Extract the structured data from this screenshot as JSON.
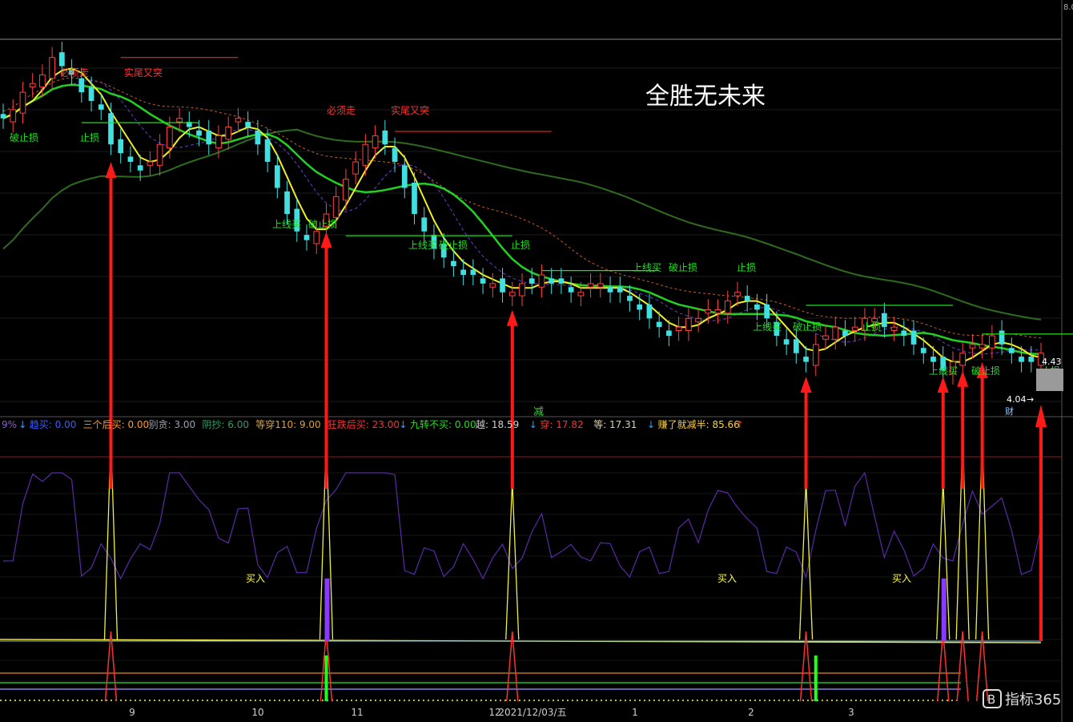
{
  "title": "全胜无未来",
  "top_axis_label": "8.0",
  "price_labels": {
    "last": "4.43",
    "low": "4.04"
  },
  "wealth_label": "财",
  "reduce_label": "减",
  "indicator_bar": [
    {
      "text": "9%",
      "color": "#8a5bd6"
    },
    {
      "text": "↓",
      "color": "#30a0ff"
    },
    {
      "text": "趋买: 0.00",
      "color": "#3a5cff"
    },
    {
      "text": "三个后买: 0.00",
      "color": "#ff9a2a"
    },
    {
      "text": "别贪: 3.00",
      "color": "#9aa0b0"
    },
    {
      "text": "阴抄: 6.00",
      "color": "#2f9e6a"
    },
    {
      "text": "等穿110: 9.00",
      "color": "#e0a030"
    },
    {
      "text": "狂跌后买: 23.00",
      "color": "#ff3030"
    },
    {
      "text": "↓",
      "color": "#30a0ff"
    },
    {
      "text": "九转不买: 0.00",
      "color": "#20e020"
    },
    {
      "text": "越: 18.59",
      "color": "#d0d0d0"
    },
    {
      "text": "↓",
      "color": "#30a0ff"
    },
    {
      "text": "穿: 17.82",
      "color": "#ff3030"
    },
    {
      "text": "等: 17.31",
      "color": "#e0d0a0"
    },
    {
      "text": "↓",
      "color": "#30a0ff"
    },
    {
      "text": "赚了就减半: 85.66",
      "color": "#ffd040"
    },
    {
      "text": "↑",
      "color": "#ff3030"
    }
  ],
  "annotations": [
    {
      "text": "必须走",
      "color": "#ff3030"
    },
    {
      "text": "实尾又突",
      "color": "#ff3030"
    },
    {
      "text": "必须走",
      "color": "#ff3030"
    },
    {
      "text": "实尾又突",
      "color": "#ff3030"
    },
    {
      "text": "破止损",
      "color": "#20e020"
    },
    {
      "text": "止损",
      "color": "#20e020"
    },
    {
      "text": "上线买",
      "color": "#20e020"
    },
    {
      "text": "破止损",
      "color": "#20e020"
    },
    {
      "text": "上线买",
      "color": "#20e020"
    },
    {
      "text": "破止损",
      "color": "#20e020"
    },
    {
      "text": "止损",
      "color": "#20e020"
    },
    {
      "text": "上线买",
      "color": "#20e020"
    },
    {
      "text": "破止损",
      "color": "#20e020"
    },
    {
      "text": "止损",
      "color": "#20e020"
    },
    {
      "text": "上线买",
      "color": "#20e020"
    },
    {
      "text": "破止损",
      "color": "#20e020"
    },
    {
      "text": "止损",
      "color": "#20e020"
    },
    {
      "text": "上线买",
      "color": "#20e020"
    },
    {
      "text": "破止损",
      "color": "#20e020"
    },
    {
      "text": "止损",
      "color": "#20e020"
    },
    {
      "text": "买入",
      "color": "#ffff40"
    },
    {
      "text": "买入",
      "color": "#ffff40"
    },
    {
      "text": "买入",
      "color": "#ffff40"
    }
  ],
  "watermark": "指标365",
  "chart_data": {
    "type": "line",
    "title": "全胜无未来",
    "x_ticks": [
      "9",
      "10",
      "11",
      "12",
      "2021/12/03/五",
      "1",
      "2",
      "3"
    ],
    "price_ylim": [
      3.9,
      8.0
    ],
    "closes": [
      7.1,
      7.2,
      7.4,
      7.5,
      7.6,
      7.8,
      7.7,
      7.6,
      7.4,
      7.3,
      7.2,
      6.8,
      6.7,
      6.6,
      6.5,
      6.6,
      6.8,
      7.0,
      7.1,
      7.0,
      6.9,
      6.8,
      6.9,
      7.0,
      7.1,
      7.0,
      6.8,
      6.6,
      6.3,
      6.0,
      5.8,
      5.7,
      5.8,
      6.0,
      6.2,
      6.4,
      6.6,
      6.8,
      6.9,
      6.8,
      6.6,
      6.3,
      6.0,
      5.8,
      5.6,
      5.5,
      5.4,
      5.3,
      5.3,
      5.2,
      5.2,
      5.1,
      5.1,
      5.2,
      5.2,
      5.3,
      5.2,
      5.2,
      5.1,
      5.1,
      5.2,
      5.2,
      5.1,
      5.1,
      5.0,
      4.9,
      4.8,
      4.7,
      4.6,
      4.7,
      4.8,
      4.8,
      4.9,
      4.9,
      5.0,
      5.1,
      5.0,
      4.9,
      4.8,
      4.6,
      4.5,
      4.4,
      4.3,
      4.5,
      4.6,
      4.7,
      4.6,
      4.7,
      4.8,
      4.8,
      4.7,
      4.7,
      4.6,
      4.5,
      4.4,
      4.3,
      4.2,
      4.3,
      4.4,
      4.5,
      4.5,
      4.6,
      4.5,
      4.4,
      4.3,
      4.3,
      4.4
    ],
    "big_arrow_bars": [
      11,
      33,
      52,
      82,
      96,
      98,
      100,
      120,
      123,
      143
    ],
    "buy_signals": [
      33,
      96,
      120
    ],
    "last_price": 4.43,
    "low_price": 4.04,
    "indicators": {
      "趋买": 0.0,
      "三个后买": 0.0,
      "别贪": 3.0,
      "阴抄": 6.0,
      "等穿110": 9.0,
      "狂跌后买": 23.0,
      "九转不买": 0.0,
      "越": 18.59,
      "穿": 17.82,
      "等": 17.31,
      "赚了就减半": 85.66
    }
  }
}
